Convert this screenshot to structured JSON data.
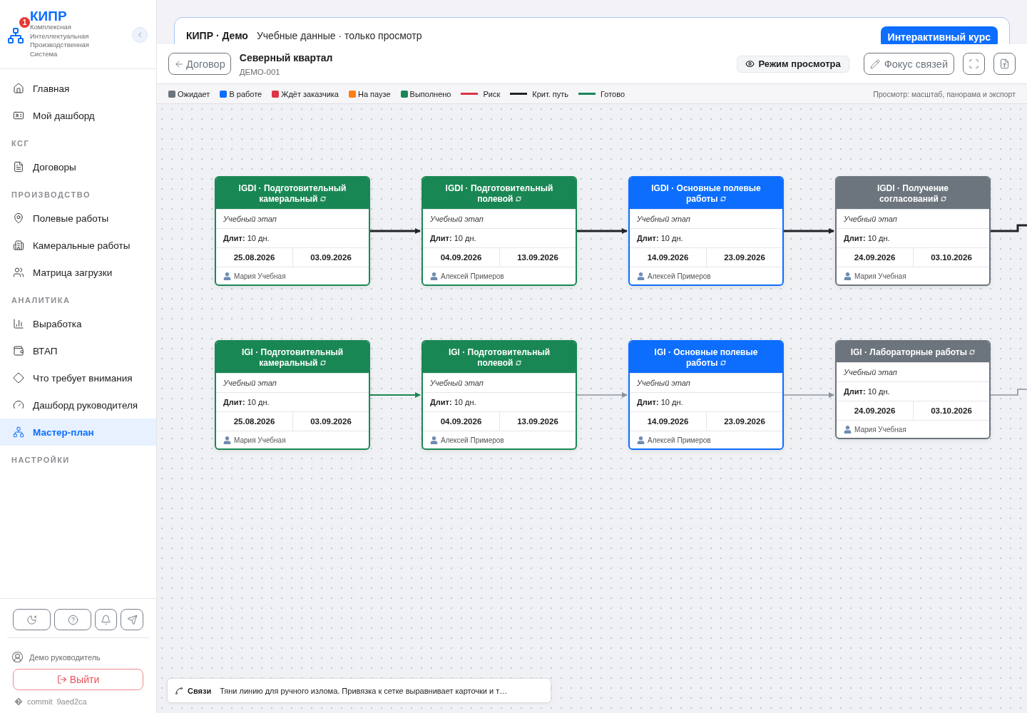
{
  "sidebar": {
    "logo": {
      "title": "КИПР",
      "subtitle": "Комплексная Интеллектуальная Производственная Система",
      "badge": "1"
    },
    "sections": [
      {
        "items": [
          {
            "label": "Главная",
            "selected": false
          },
          {
            "label": "Мой дашборд",
            "selected": false
          }
        ]
      },
      {
        "label": "КСГ",
        "items": [
          {
            "label": "Договоры",
            "selected": false
          }
        ]
      },
      {
        "label": "ПРОИЗВОДСТВО",
        "items": [
          {
            "label": "Полевые работы",
            "selected": false
          },
          {
            "label": "Камеральные работы",
            "selected": false
          },
          {
            "label": "Матрица загрузки",
            "selected": false
          }
        ]
      },
      {
        "label": "АНАЛИТИКА",
        "items": [
          {
            "label": "Выработка",
            "selected": false
          },
          {
            "label": "ВТАП",
            "selected": false
          },
          {
            "label": "Что требует внимания",
            "selected": false
          },
          {
            "label": "Дашборд руководителя",
            "selected": false
          },
          {
            "label": "Мастер-план",
            "selected": true
          }
        ]
      },
      {
        "label": "НАСТРОЙКИ"
      }
    ],
    "user": "Демо руководитель",
    "logout": "Выйти",
    "commit": {
      "label": "commit",
      "hash": "9aed2ca"
    }
  },
  "banner": {
    "title": "КИПР · Демо",
    "text": "Учебные данные · только просмотр",
    "button": "Интерактивный курс"
  },
  "header": {
    "back": "Договор",
    "title": "Северный квартал",
    "code": "ДЕМО-001",
    "view_mode": "Режим просмотра",
    "focus": "Фокус связей"
  },
  "legend": {
    "items": [
      {
        "kind": "status",
        "label": "Ожидает",
        "color": "#6c757d"
      },
      {
        "kind": "status",
        "label": "В работе",
        "color": "#0d6efd"
      },
      {
        "kind": "status",
        "label": "Ждёт заказчика",
        "color": "#dc3545"
      },
      {
        "kind": "status",
        "label": "На паузе",
        "color": "#fd7e14"
      },
      {
        "kind": "status",
        "label": "Выполнено",
        "color": "#198754"
      },
      {
        "kind": "line",
        "label": "Риск",
        "color": "#dc3545"
      },
      {
        "kind": "line",
        "label": "Крит. путь",
        "color": "#212529"
      },
      {
        "kind": "line",
        "label": "Готово",
        "color": "#198754"
      }
    ],
    "hint": "Просмотр: масштаб, панорама и экспорт"
  },
  "cards": [
    {
      "kind": "done",
      "title": "IGDI · Подготовительный камеральный",
      "subtitle": "Учебный этап",
      "duration": "**Длит:** 10 дн.",
      "start": "25.08.2026",
      "end": "03.09.2026",
      "owner": "Мария Учебная",
      "link": {
        "kind": "critical"
      }
    },
    {
      "kind": "done",
      "title": "IGDI · Подготовительный полевой",
      "subtitle": "Учебный этап",
      "duration": "**Длит:** 10 дн.",
      "start": "04.09.2026",
      "end": "13.09.2026",
      "owner": "Алексей Примеров",
      "link": {
        "kind": "critical"
      }
    },
    {
      "kind": "active",
      "title": "IGDI · Основные полевые работы",
      "subtitle": "Учебный этап",
      "duration": "**Длит:** 10 дн.",
      "start": "14.09.2026",
      "end": "23.09.2026",
      "owner": "Алексей Примеров",
      "link": {
        "kind": "critical"
      }
    },
    {
      "kind": "waiting",
      "title": "IGDI · Получение согласований",
      "subtitle": "Учебный этап",
      "duration": "**Длит:** 10 дн.",
      "start": "24.09.2026",
      "end": "03.10.2026",
      "owner": "Мария Учебная",
      "link": {
        "kind": "critical"
      }
    },
    {
      "kind": "done",
      "title": "IGI · Подготовительный камеральный",
      "subtitle": "Учебный этап",
      "duration": "**Длит:** 10 дн.",
      "start": "25.08.2026",
      "end": "03.09.2026",
      "owner": "Мария Учебная",
      "link": {
        "kind": "done"
      }
    },
    {
      "kind": "done",
      "title": "IGI · Подготовительный полевой",
      "subtitle": "Учебный этап",
      "duration": "**Длит:** 10 дн.",
      "start": "04.09.2026",
      "end": "13.09.2026",
      "owner": "Алексей Примеров",
      "link": {
        "kind": "plain"
      }
    },
    {
      "kind": "active",
      "title": "IGI · Основные полевые работы",
      "subtitle": "Учебный этап",
      "duration": "**Длит:** 10 дн.",
      "start": "14.09.2026",
      "end": "23.09.2026",
      "owner": "Алексей Примеров",
      "link": {
        "kind": "plain"
      }
    },
    {
      "kind": "waiting",
      "title": "IGI · Лабораторные работы",
      "subtitle": "Учебный этап",
      "duration": "**Длит:** 10 дн.",
      "start": "24.09.2026",
      "end": "03.10.2026",
      "owner": "Мария Учебная",
      "link": {
        "kind": "plain"
      }
    }
  ],
  "toast": {
    "title": "Связи",
    "text": "Тяни линию для ручного излома. Привязка к сетке выравнивает карточки и т…"
  }
}
